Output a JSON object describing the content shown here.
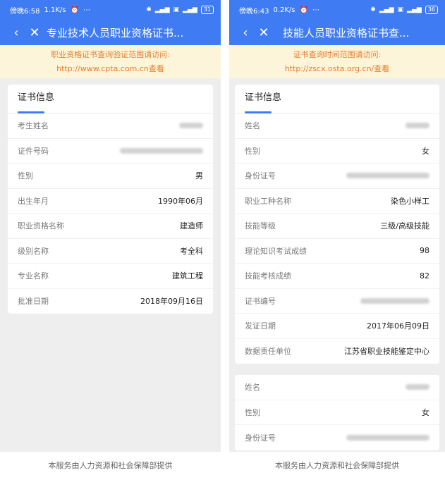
{
  "left": {
    "status": {
      "time": "傍晚6:58",
      "speed": "1.1K/s",
      "battery": "31"
    },
    "nav": {
      "title": "专业技术人员职业资格证书..."
    },
    "notice": {
      "line1": "职业资格证书查询验证范围请访问:",
      "line2": "http://www.cpta.com.cn查看"
    },
    "card": {
      "title": "证书信息",
      "rows": [
        {
          "label": "考生姓名",
          "value": "",
          "blurred": true
        },
        {
          "label": "证件号码",
          "value": "",
          "blurred": true
        },
        {
          "label": "性别",
          "value": "男"
        },
        {
          "label": "出生年月",
          "value": "1990年06月"
        },
        {
          "label": "职业资格名称",
          "value": "建造师"
        },
        {
          "label": "级别名称",
          "value": "考全科"
        },
        {
          "label": "专业名称",
          "value": "建筑工程"
        },
        {
          "label": "批准日期",
          "value": "2018年09月16日"
        }
      ]
    },
    "footer": "本服务由人力资源和社会保障部提供"
  },
  "right": {
    "status": {
      "time": "傍晚6:43",
      "speed": "0.2K/s",
      "battery": "36"
    },
    "nav": {
      "title": "技能人员职业资格证书查..."
    },
    "notice": {
      "line1": "证书查询时间范围请访问:",
      "line2": "http://zscx.osta.org.cn/查看"
    },
    "card": {
      "title": "证书信息",
      "rows": [
        {
          "label": "姓名",
          "value": "",
          "blurred": true
        },
        {
          "label": "性别",
          "value": "女"
        },
        {
          "label": "身份证号",
          "value": "",
          "blurred": true
        },
        {
          "label": "职业工种名称",
          "value": "染色小样工"
        },
        {
          "label": "技能等级",
          "value": "三级/高级技能"
        },
        {
          "label": "理论知识考试成绩",
          "value": "98"
        },
        {
          "label": "技能考核成绩",
          "value": "82"
        },
        {
          "label": "证书编号",
          "value": "",
          "blurred": true
        },
        {
          "label": "发证日期",
          "value": "2017年06月09日"
        },
        {
          "label": "数据责任单位",
          "value": "江苏省职业技能鉴定中心"
        }
      ]
    },
    "card2": {
      "rows": [
        {
          "label": "姓名",
          "value": "",
          "blurred": true
        },
        {
          "label": "性别",
          "value": "女"
        },
        {
          "label": "身份证号",
          "value": "",
          "blurred": true
        }
      ]
    },
    "footer": "本服务由人力资源和社会保障部提供"
  }
}
